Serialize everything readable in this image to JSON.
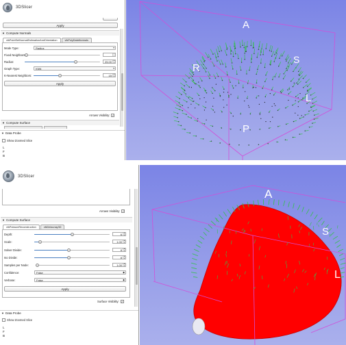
{
  "app": {
    "logo_text": "3DSlicer"
  },
  "top_panel": {
    "apply_top_label": "Apply",
    "compute_normals_header": "Compute Normals",
    "tabs": [
      "vtkPointSetNormalEstimationAndOrientation",
      "vtkPolyDataNormals"
    ],
    "mode_type": {
      "label": "Mode Type:",
      "value": "Radius"
    },
    "fixed_neighbors": {
      "label": "Fixed Neighbors:",
      "value": "",
      "fraction": 0.0
    },
    "radius": {
      "label": "Radius:",
      "value": "25.00",
      "fraction": 0.68
    },
    "graph_type": {
      "label": "Graph Type:",
      "value": "KNN"
    },
    "k_nearest": {
      "label": "K-Nearest Neighbors:",
      "value": "15",
      "fraction": 0.4
    },
    "apply_label": "Apply",
    "arrows_visibility_label": "Arrows Visibility:",
    "arrows_visibility_checked": true,
    "compute_surface_header": "Compute Surface",
    "data_probe_header": "Data Probe",
    "show_zoomed_slice_label": "Show Zoomed Slice",
    "probe_letters": [
      "L",
      "F",
      "B"
    ]
  },
  "bottom_panel": {
    "arrows_visibility_label": "Arrows Visibility:",
    "arrows_visibility_checked": true,
    "compute_surface_header": "Compute Surface",
    "tabs": [
      "vtkPoissonReconstruction",
      "vtkDelaunay3D"
    ],
    "depth": {
      "label": "Depth:",
      "value": "6",
      "fraction": 0.5
    },
    "scale": {
      "label": "Scale:",
      "value": "1.00",
      "fraction": 0.08
    },
    "solver_divide": {
      "label": "Solver Divide:",
      "value": "8",
      "fraction": 0.46
    },
    "iso_divide": {
      "label": "Iso Divide:",
      "value": "8",
      "fraction": 0.46
    },
    "samples_per_node": {
      "label": "Samples per Node:",
      "value": "1.00",
      "fraction": 0.0
    },
    "confidence": {
      "label": "Confidence:",
      "value": "False"
    },
    "verbose": {
      "label": "Verbose:",
      "value": "False"
    },
    "apply_label": "Apply",
    "surface_visibility_label": "Surface Visibility:",
    "surface_visibility_checked": true,
    "data_probe_header": "Data Probe",
    "show_zoomed_slice_label": "Show Zoomed Slice",
    "probe_letters": [
      "L",
      "F",
      "B"
    ]
  },
  "views": {
    "top_axes": [
      "A",
      "R",
      "S",
      "L",
      "P"
    ],
    "bottom_axes": [
      "A",
      "S",
      "L"
    ],
    "colors": {
      "background_top": "#7b84e6",
      "background_bottom": "#aab0ec",
      "bounding_box": "#d24fd8",
      "points": "#1a1a1a",
      "normals": "#33c24a",
      "surface": "#ff0000"
    }
  }
}
